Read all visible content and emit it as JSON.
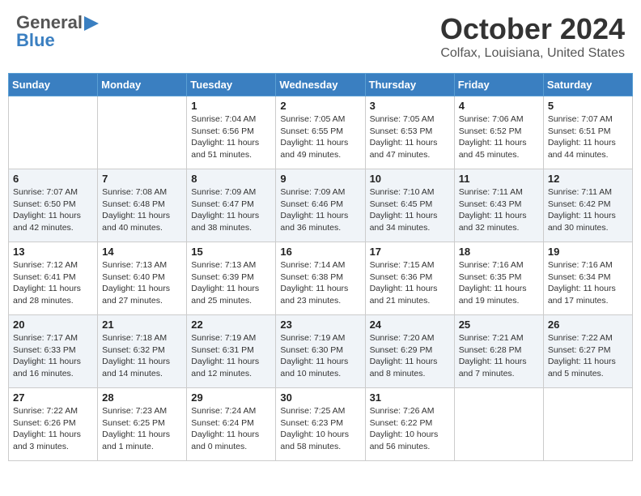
{
  "header": {
    "logo_general": "General",
    "logo_blue": "Blue",
    "month_title": "October 2024",
    "location": "Colfax, Louisiana, United States"
  },
  "days_of_week": [
    "Sunday",
    "Monday",
    "Tuesday",
    "Wednesday",
    "Thursday",
    "Friday",
    "Saturday"
  ],
  "weeks": [
    [
      {
        "day": null,
        "data": null
      },
      {
        "day": null,
        "data": null
      },
      {
        "day": "1",
        "data": {
          "sunrise": "Sunrise: 7:04 AM",
          "sunset": "Sunset: 6:56 PM",
          "daylight": "Daylight: 11 hours and 51 minutes."
        }
      },
      {
        "day": "2",
        "data": {
          "sunrise": "Sunrise: 7:05 AM",
          "sunset": "Sunset: 6:55 PM",
          "daylight": "Daylight: 11 hours and 49 minutes."
        }
      },
      {
        "day": "3",
        "data": {
          "sunrise": "Sunrise: 7:05 AM",
          "sunset": "Sunset: 6:53 PM",
          "daylight": "Daylight: 11 hours and 47 minutes."
        }
      },
      {
        "day": "4",
        "data": {
          "sunrise": "Sunrise: 7:06 AM",
          "sunset": "Sunset: 6:52 PM",
          "daylight": "Daylight: 11 hours and 45 minutes."
        }
      },
      {
        "day": "5",
        "data": {
          "sunrise": "Sunrise: 7:07 AM",
          "sunset": "Sunset: 6:51 PM",
          "daylight": "Daylight: 11 hours and 44 minutes."
        }
      }
    ],
    [
      {
        "day": "6",
        "data": {
          "sunrise": "Sunrise: 7:07 AM",
          "sunset": "Sunset: 6:50 PM",
          "daylight": "Daylight: 11 hours and 42 minutes."
        }
      },
      {
        "day": "7",
        "data": {
          "sunrise": "Sunrise: 7:08 AM",
          "sunset": "Sunset: 6:48 PM",
          "daylight": "Daylight: 11 hours and 40 minutes."
        }
      },
      {
        "day": "8",
        "data": {
          "sunrise": "Sunrise: 7:09 AM",
          "sunset": "Sunset: 6:47 PM",
          "daylight": "Daylight: 11 hours and 38 minutes."
        }
      },
      {
        "day": "9",
        "data": {
          "sunrise": "Sunrise: 7:09 AM",
          "sunset": "Sunset: 6:46 PM",
          "daylight": "Daylight: 11 hours and 36 minutes."
        }
      },
      {
        "day": "10",
        "data": {
          "sunrise": "Sunrise: 7:10 AM",
          "sunset": "Sunset: 6:45 PM",
          "daylight": "Daylight: 11 hours and 34 minutes."
        }
      },
      {
        "day": "11",
        "data": {
          "sunrise": "Sunrise: 7:11 AM",
          "sunset": "Sunset: 6:43 PM",
          "daylight": "Daylight: 11 hours and 32 minutes."
        }
      },
      {
        "day": "12",
        "data": {
          "sunrise": "Sunrise: 7:11 AM",
          "sunset": "Sunset: 6:42 PM",
          "daylight": "Daylight: 11 hours and 30 minutes."
        }
      }
    ],
    [
      {
        "day": "13",
        "data": {
          "sunrise": "Sunrise: 7:12 AM",
          "sunset": "Sunset: 6:41 PM",
          "daylight": "Daylight: 11 hours and 28 minutes."
        }
      },
      {
        "day": "14",
        "data": {
          "sunrise": "Sunrise: 7:13 AM",
          "sunset": "Sunset: 6:40 PM",
          "daylight": "Daylight: 11 hours and 27 minutes."
        }
      },
      {
        "day": "15",
        "data": {
          "sunrise": "Sunrise: 7:13 AM",
          "sunset": "Sunset: 6:39 PM",
          "daylight": "Daylight: 11 hours and 25 minutes."
        }
      },
      {
        "day": "16",
        "data": {
          "sunrise": "Sunrise: 7:14 AM",
          "sunset": "Sunset: 6:38 PM",
          "daylight": "Daylight: 11 hours and 23 minutes."
        }
      },
      {
        "day": "17",
        "data": {
          "sunrise": "Sunrise: 7:15 AM",
          "sunset": "Sunset: 6:36 PM",
          "daylight": "Daylight: 11 hours and 21 minutes."
        }
      },
      {
        "day": "18",
        "data": {
          "sunrise": "Sunrise: 7:16 AM",
          "sunset": "Sunset: 6:35 PM",
          "daylight": "Daylight: 11 hours and 19 minutes."
        }
      },
      {
        "day": "19",
        "data": {
          "sunrise": "Sunrise: 7:16 AM",
          "sunset": "Sunset: 6:34 PM",
          "daylight": "Daylight: 11 hours and 17 minutes."
        }
      }
    ],
    [
      {
        "day": "20",
        "data": {
          "sunrise": "Sunrise: 7:17 AM",
          "sunset": "Sunset: 6:33 PM",
          "daylight": "Daylight: 11 hours and 16 minutes."
        }
      },
      {
        "day": "21",
        "data": {
          "sunrise": "Sunrise: 7:18 AM",
          "sunset": "Sunset: 6:32 PM",
          "daylight": "Daylight: 11 hours and 14 minutes."
        }
      },
      {
        "day": "22",
        "data": {
          "sunrise": "Sunrise: 7:19 AM",
          "sunset": "Sunset: 6:31 PM",
          "daylight": "Daylight: 11 hours and 12 minutes."
        }
      },
      {
        "day": "23",
        "data": {
          "sunrise": "Sunrise: 7:19 AM",
          "sunset": "Sunset: 6:30 PM",
          "daylight": "Daylight: 11 hours and 10 minutes."
        }
      },
      {
        "day": "24",
        "data": {
          "sunrise": "Sunrise: 7:20 AM",
          "sunset": "Sunset: 6:29 PM",
          "daylight": "Daylight: 11 hours and 8 minutes."
        }
      },
      {
        "day": "25",
        "data": {
          "sunrise": "Sunrise: 7:21 AM",
          "sunset": "Sunset: 6:28 PM",
          "daylight": "Daylight: 11 hours and 7 minutes."
        }
      },
      {
        "day": "26",
        "data": {
          "sunrise": "Sunrise: 7:22 AM",
          "sunset": "Sunset: 6:27 PM",
          "daylight": "Daylight: 11 hours and 5 minutes."
        }
      }
    ],
    [
      {
        "day": "27",
        "data": {
          "sunrise": "Sunrise: 7:22 AM",
          "sunset": "Sunset: 6:26 PM",
          "daylight": "Daylight: 11 hours and 3 minutes."
        }
      },
      {
        "day": "28",
        "data": {
          "sunrise": "Sunrise: 7:23 AM",
          "sunset": "Sunset: 6:25 PM",
          "daylight": "Daylight: 11 hours and 1 minute."
        }
      },
      {
        "day": "29",
        "data": {
          "sunrise": "Sunrise: 7:24 AM",
          "sunset": "Sunset: 6:24 PM",
          "daylight": "Daylight: 11 hours and 0 minutes."
        }
      },
      {
        "day": "30",
        "data": {
          "sunrise": "Sunrise: 7:25 AM",
          "sunset": "Sunset: 6:23 PM",
          "daylight": "Daylight: 10 hours and 58 minutes."
        }
      },
      {
        "day": "31",
        "data": {
          "sunrise": "Sunrise: 7:26 AM",
          "sunset": "Sunset: 6:22 PM",
          "daylight": "Daylight: 10 hours and 56 minutes."
        }
      },
      {
        "day": null,
        "data": null
      },
      {
        "day": null,
        "data": null
      }
    ]
  ]
}
